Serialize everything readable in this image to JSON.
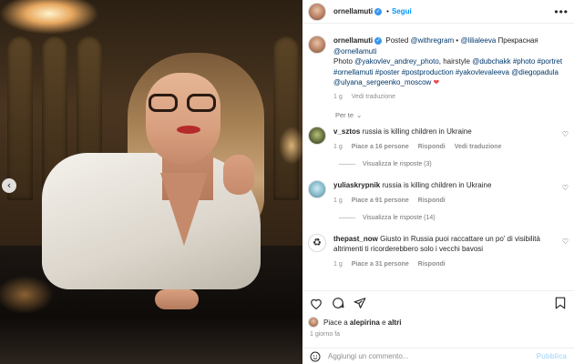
{
  "header": {
    "username": "ornellamuti",
    "follow_label": "Segui",
    "more_label": "•••"
  },
  "caption": {
    "username": "ornellamuti",
    "posted_label": "Posted",
    "mention_1": "@withregram",
    "separator": "•",
    "mention_2": "@lilialeeva",
    "word_1": "Прекрасная",
    "mention_3": "@ornellamuti",
    "photo_label": "Photo",
    "mention_4": "@yakovlev_andrey_photo",
    "hairstyle_label": ", hairstyle",
    "mention_5": "@dubchakk",
    "tags": "#photo #portret #ornellamuti #poster #postproduction #yakovlevaleeva",
    "mention_6": "@diegopadula",
    "mention_7": "@ulyana_sergeenko_moscow",
    "time": "1 g",
    "translate": "Vedi traduzione"
  },
  "for_you_label": "Per te",
  "comments": [
    {
      "username": "v_sztos",
      "text": "russia is killing children in Ukraine",
      "time": "1 g",
      "likes": "Piace a 16 persone",
      "reply": "Rispondi",
      "translate": "Vedi traduzione",
      "replies": "Visualizza le risposte (3)"
    },
    {
      "username": "yuliaskrypnik",
      "text": "russia is killing children in Ukraine",
      "time": "1 g",
      "likes": "Piace a 91 persone",
      "reply": "Rispondi",
      "replies": "Visualizza le risposte (14)"
    },
    {
      "username": "thepast_now",
      "text": "Giusto in Russia puoi raccattare un po' di visibilità altrimenti ti ricorderebbero solo i vecchi bavosi",
      "time": "1 g",
      "likes": "Piace a 31 persone",
      "reply": "Rispondi"
    }
  ],
  "likes": {
    "prefix": "Piace a",
    "user": "alepirina",
    "joiner": "e",
    "others": "altri"
  },
  "posted_ago": "1 giorno fa",
  "add_comment": {
    "placeholder": "Aggiungi un commento...",
    "publish_label": "Pubblica"
  },
  "colors": {
    "link": "#00376b",
    "follow": "#0095f6",
    "verified": "#3897f0",
    "heart": "#ed4956"
  }
}
